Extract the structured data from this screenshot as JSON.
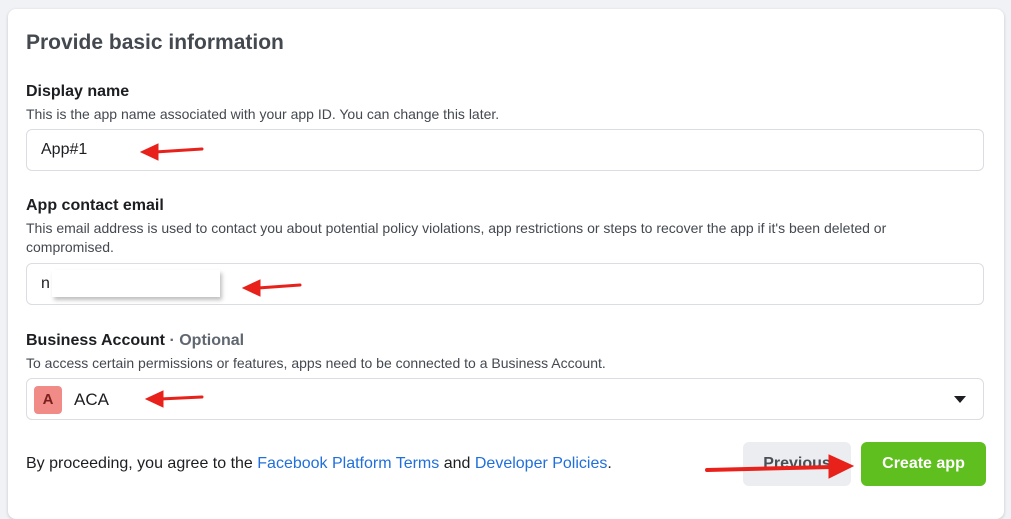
{
  "form": {
    "title": "Provide basic information",
    "display_name": {
      "label": "Display name",
      "description": "This is the app name associated with your app ID. You can change this later.",
      "value": "App#1"
    },
    "contact_email": {
      "label": "App contact email",
      "description": "This email address is used to contact you about potential policy violations, app restrictions or steps to recover the app if it's been deleted or compromised.",
      "value": "n"
    },
    "business_account": {
      "label": "Business Account",
      "optional": "· Optional",
      "description": "To access certain permissions or features, apps need to be connected to a Business Account.",
      "avatar_letter": "A",
      "value": "ACA"
    },
    "terms": {
      "prefix": "By proceeding, you agree to the ",
      "platform_terms": "Facebook Platform Terms",
      "and": " and ",
      "developer_policies": "Developer Policies",
      "suffix": "."
    },
    "buttons": {
      "previous": "Previous",
      "create": "Create app"
    }
  },
  "colors": {
    "accent_link": "#216fdb",
    "create_button": "#5fbf1f",
    "annotation_arrow": "#e8211b",
    "avatar_bg": "#f08b87"
  }
}
